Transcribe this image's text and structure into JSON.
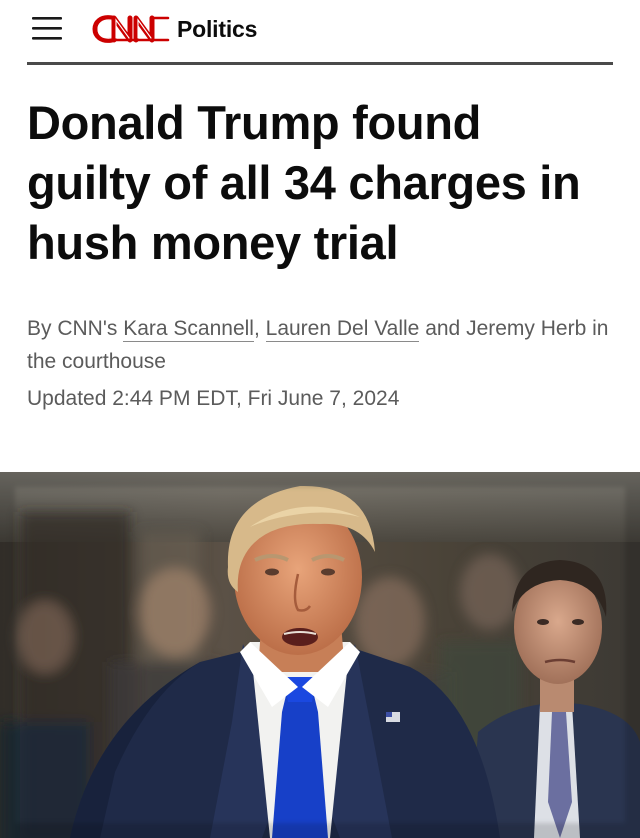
{
  "header": {
    "brand": "CNN",
    "section": "Politics",
    "brand_color": "#cc0000"
  },
  "article": {
    "headline": "Donald Trump found guilty of all 34 charges in hush money trial",
    "byline": {
      "prefix": "By CNN's",
      "author_1": "Kara Scannell",
      "separator": ",",
      "author_2": "Lauren Del Valle",
      "connector": "and Jeremy Herb in the courthouse"
    },
    "updated": "Updated 2:44 PM EDT, Fri June 7, 2024"
  },
  "hero_image": {
    "subject": "photo of Donald Trump speaking in a courthouse hallway, wearing a dark suit and blue tie, with a man in a gray suit behind him"
  },
  "icons": {
    "menu": "hamburger-menu-icon",
    "logo": "cnn-logo"
  }
}
